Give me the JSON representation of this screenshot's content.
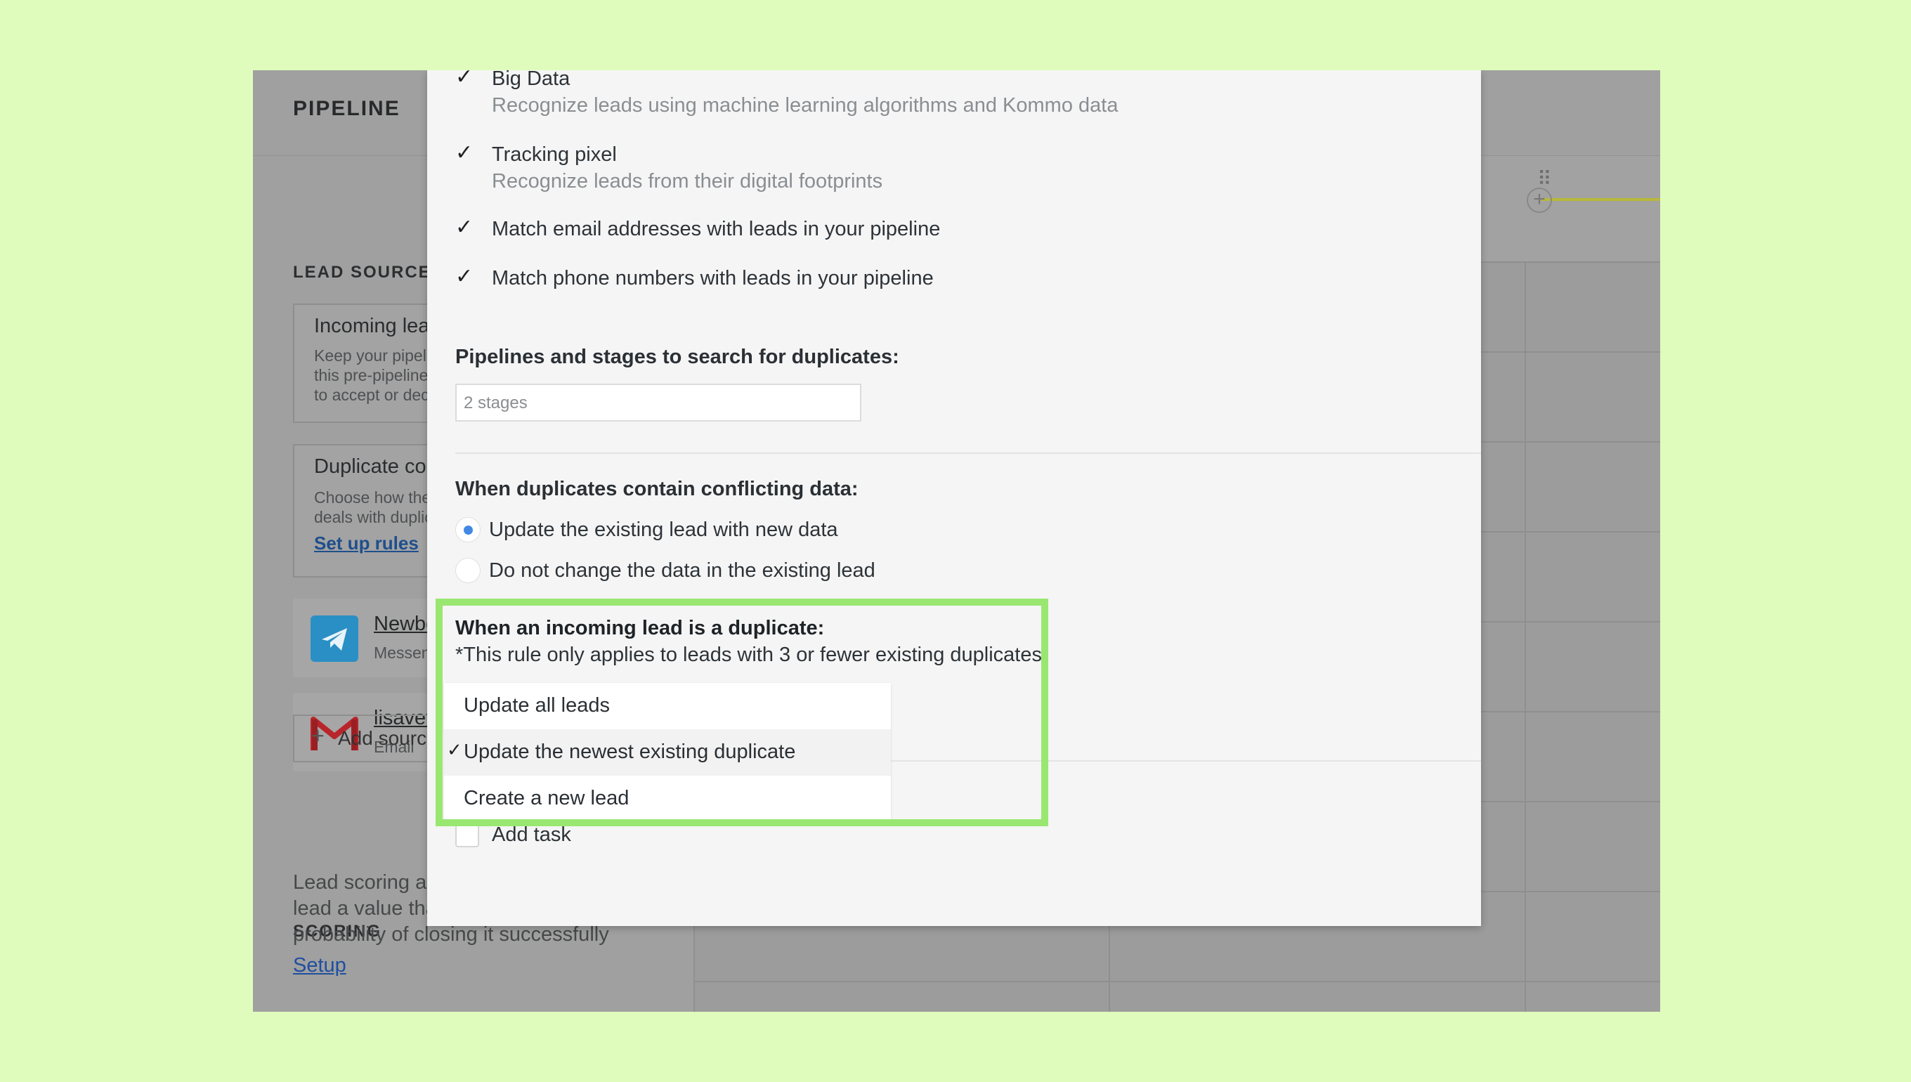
{
  "app": {
    "title": "PIPELINE",
    "lead_sources_title": "LEAD SOURCES",
    "incoming": {
      "title": "Incoming leads",
      "desc": "Keep your pipeline clean by using\nthis pre-pipeline stage\nto accept or decline"
    },
    "duplicate": {
      "title": "Duplicate control",
      "desc": "Choose how the system deals\ndeals with duplicates",
      "link": "Set up rules"
    },
    "sources": [
      {
        "name": "Newbot",
        "sub": "Messenger"
      },
      {
        "name": "lisavet",
        "sub": "Email"
      }
    ],
    "add_source": "Add source",
    "scoring_title": "SCORING",
    "scoring_desc": "Lead scoring allows you to give each\nlead a value that represents the\nprobability of closing it successfully",
    "setup_link": "Setup"
  },
  "modal": {
    "checks": [
      {
        "label": "Big Data",
        "desc": "Recognize leads using machine learning algorithms and Kommo data",
        "checked": true
      },
      {
        "label": "Tracking pixel",
        "desc": "Recognize leads from their digital footprints",
        "checked": true
      },
      {
        "label": "Match email addresses with leads in your pipeline",
        "checked": true
      },
      {
        "label": "Match phone numbers with leads in your pipeline",
        "checked": true
      }
    ],
    "pipelines_label": "Pipelines and stages to search for duplicates:",
    "pipelines_value": "2 stages",
    "conflict_label": "When duplicates contain conflicting data:",
    "conflict_options": [
      {
        "label": "Update the existing lead with new data",
        "selected": true
      },
      {
        "label": "Do not change the data in the existing lead",
        "selected": false
      }
    ],
    "duplicate_label": "When an incoming lead is a duplicate:",
    "duplicate_note": "*This rule only applies to leads with 3 or fewer existing duplicates",
    "duplicate_options": [
      {
        "label": "Update all leads",
        "selected": false
      },
      {
        "label": "Update the newest existing duplicate",
        "selected": true
      },
      {
        "label": "Create a new lead",
        "selected": false
      }
    ],
    "checkmark": "✓",
    "add_task": "Add task"
  },
  "colors": {
    "page_background": "#e0fcbc",
    "highlight": "#99e771",
    "radio_active": "#4288e4",
    "link": "#1f4fa0"
  }
}
